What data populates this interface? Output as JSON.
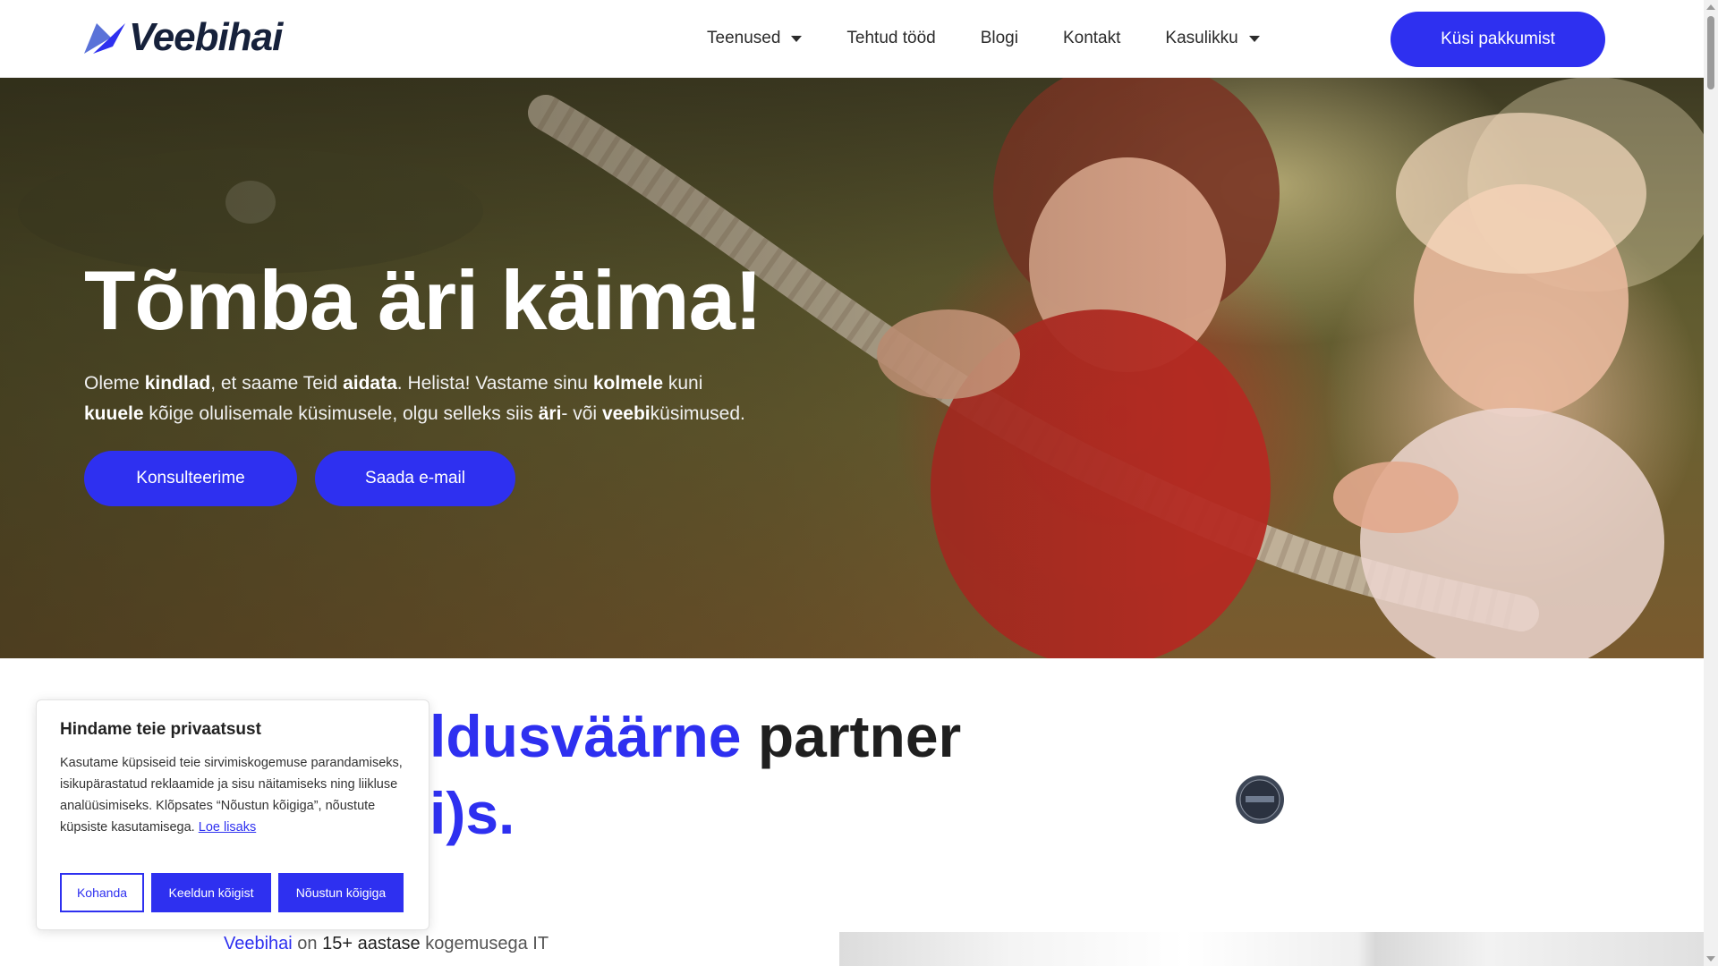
{
  "header": {
    "logo_text": "Veebihai",
    "nav": [
      {
        "label": "Teenused",
        "has_dropdown": true
      },
      {
        "label": "Tehtud tööd",
        "has_dropdown": false
      },
      {
        "label": "Blogi",
        "has_dropdown": false
      },
      {
        "label": "Kontakt",
        "has_dropdown": false
      },
      {
        "label": "Kasulikku",
        "has_dropdown": true
      }
    ],
    "cta_label": "Küsi pakkumist"
  },
  "hero": {
    "title": "Tõmba äri käima!",
    "text_parts": [
      {
        "t": "Oleme ",
        "b": false
      },
      {
        "t": "kindlad",
        "b": true
      },
      {
        "t": ", et saame Teid ",
        "b": false
      },
      {
        "t": "aidata",
        "b": true
      },
      {
        "t": ". Helista! Vastame sinu ",
        "b": false
      },
      {
        "t": "kolmele",
        "b": true
      },
      {
        "t": " kuni ",
        "b": false
      },
      {
        "t": "kuuele",
        "b": true
      },
      {
        "t": " kõige olulisemale küsimusele, olgu selleks siis ",
        "b": false
      },
      {
        "t": "äri",
        "b": true
      },
      {
        "t": "- või ",
        "b": false
      },
      {
        "t": "veebi",
        "b": true
      },
      {
        "t": "küsimused.",
        "b": false
      }
    ],
    "buttons": [
      "Konsulteerime",
      "Saada e-mail"
    ]
  },
  "section": {
    "heading_line1_blue": "ldusväärne",
    "heading_line1_rest": " partner",
    "heading_line2": "i)s.",
    "intro_brand": "Veebihai",
    "intro_mid": " on ",
    "intro_bold": "15+ aastase",
    "intro_end": " kogemusega IT"
  },
  "cookie": {
    "title": "Hindame teie privaatsust",
    "text": "Kasutame küpsiseid teie sirvimiskogemuse parandamiseks, isikupärastatud reklaamide ja sisu näitamiseks ning liikluse analüüsimiseks. Klõpsates “Nõustun kõigiga”, nõustute küpsiste kasutamisega.",
    "link": "Loe lisaks",
    "buttons": {
      "customize": "Kohanda",
      "reject": "Keeldun kõigist",
      "accept": "Nõustun kõigiga"
    }
  },
  "colors": {
    "accent": "#2e30f0",
    "dark": "#16213b"
  },
  "icons": {
    "badge": "award-badge-icon",
    "caret": "caret-down-icon"
  }
}
